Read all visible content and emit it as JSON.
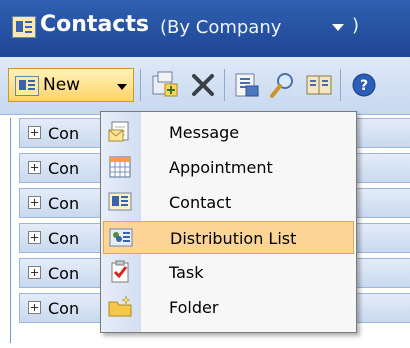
{
  "title": {
    "main": "Contacts",
    "view": "(By Company",
    "close": ")"
  },
  "toolbar": {
    "new_label": "New"
  },
  "rows": [
    {
      "label": "Con"
    },
    {
      "label": "Con"
    },
    {
      "label": "Con"
    },
    {
      "label": "Con"
    },
    {
      "label": "Con"
    },
    {
      "label": "Con"
    }
  ],
  "new_menu": {
    "items": [
      {
        "label": "Message",
        "icon": "message-icon"
      },
      {
        "label": "Appointment",
        "icon": "calendar-icon"
      },
      {
        "label": "Contact",
        "icon": "contact-card-icon"
      },
      {
        "label": "Distribution List",
        "icon": "distribution-list-icon",
        "highlighted": true
      },
      {
        "label": "Task",
        "icon": "task-icon"
      },
      {
        "label": "Folder",
        "icon": "folder-icon"
      }
    ]
  }
}
